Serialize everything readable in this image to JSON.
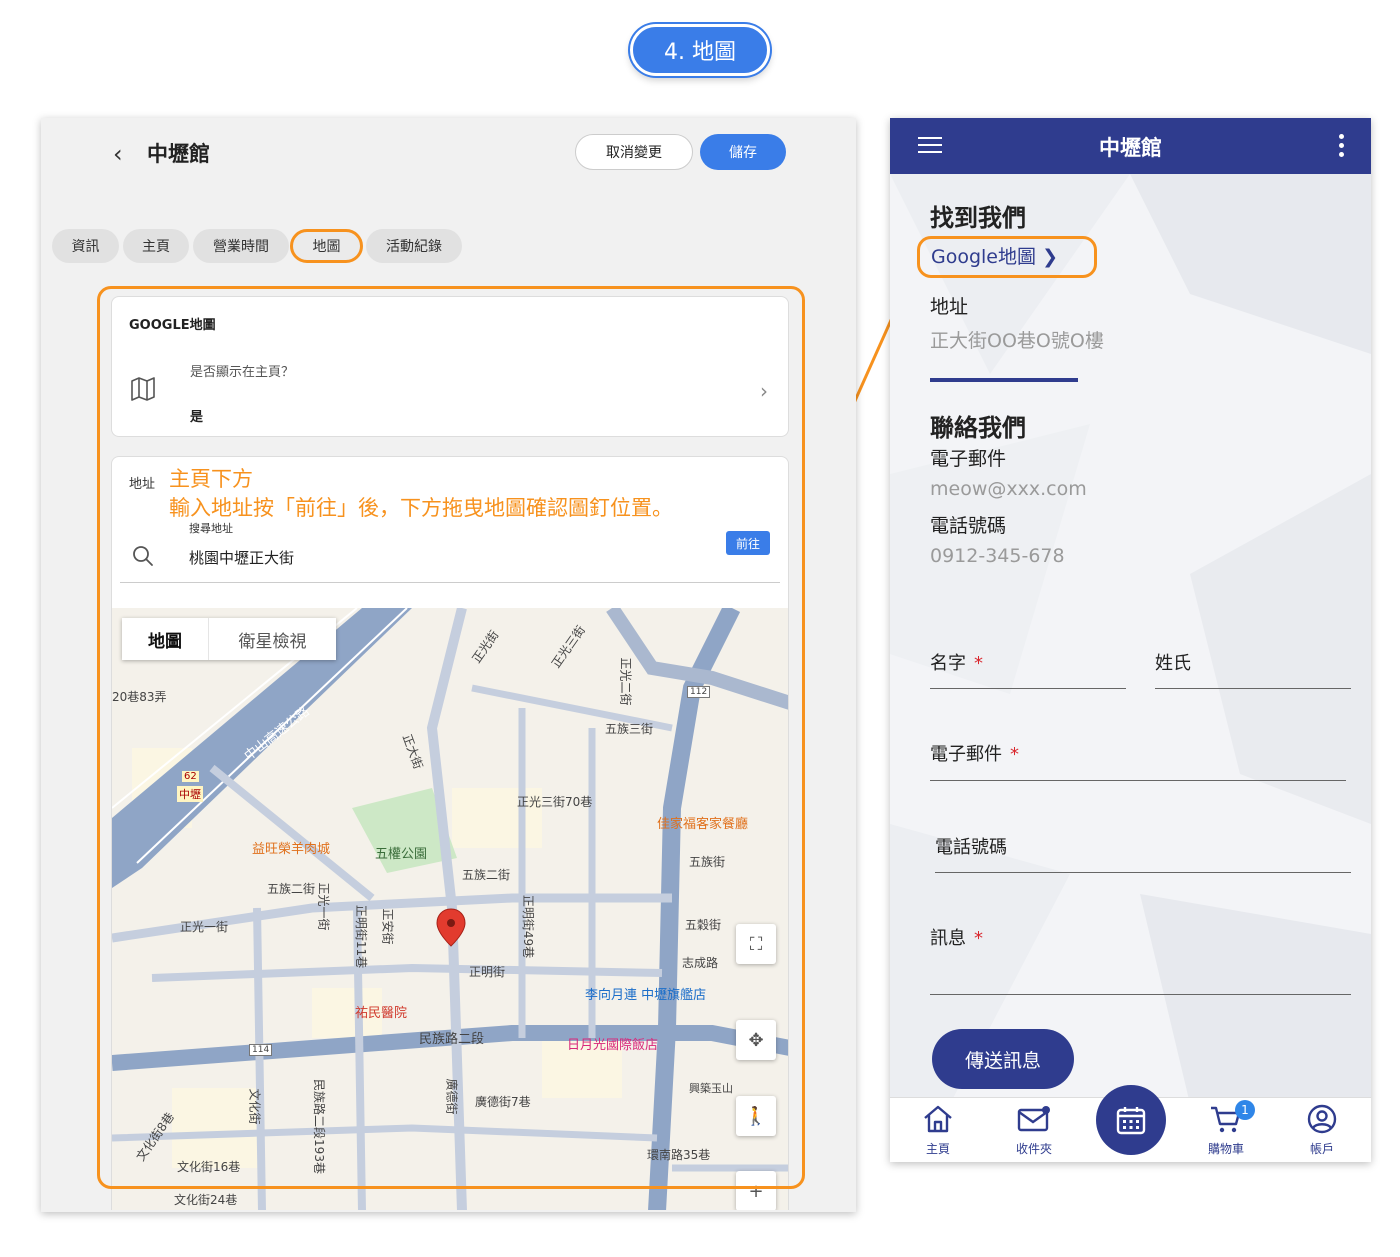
{
  "step": {
    "label": "4. 地圖"
  },
  "admin": {
    "title": "中壢館",
    "cancel_label": "取消變更",
    "save_label": "儲存",
    "tabs": [
      {
        "label": "資訊"
      },
      {
        "label": "主頁"
      },
      {
        "label": "營業時間"
      },
      {
        "label": "地圖",
        "active": true
      },
      {
        "label": "活動紀錄"
      }
    ],
    "google_map_card": {
      "heading": "GOOGLE地圖",
      "question": "是否顯示在主頁？",
      "answer": "是",
      "icon": "map-icon"
    },
    "address_card": {
      "label": "地址",
      "note_line1": "主頁下方",
      "note_line2": "輸入地址按「前往」後，下方拖曳地圖確認圖釘位置。",
      "search_label": "搜尋地址",
      "search_value": "桃園中壢正大街",
      "go_label": "前往"
    },
    "map": {
      "toggle_map": "地圖",
      "toggle_satellite": "衛星檢視",
      "labels": {
        "l1": "20巷83弄",
        "l2": "中山高速公路",
        "l3": "正光街",
        "l4": "正光三街",
        "l5": "正光二街",
        "l6": "五族三街",
        "l7": "正大街",
        "l8": "正光三街70巷",
        "l9": "佳家福客家餐廳",
        "l10": "益旺榮羊肉城",
        "l11": "五權公園",
        "l12": "五族二街",
        "l13": "五族二街",
        "l14": "五族街",
        "l15": "正光一街",
        "l16": "五穀街",
        "l17": "志成路",
        "l18": "正明街",
        "l19": "李向月連 中壢旗艦店",
        "l20": "祐民醫院",
        "l21": "民族路二段",
        "l22": "日月光國際飯店",
        "l23": "興築玉山",
        "l24": "廣德街7巷",
        "l25": "文化街16巷",
        "l26": "文化街24巷",
        "l27": "環南路35巷",
        "l28": "中壢",
        "l29": "62",
        "l30": "112",
        "l31": "114",
        "l32": "正光一街",
        "l33": "正明街11巷",
        "l34": "正明街49巷",
        "l35": "正安街",
        "l36": "文化街",
        "l37": "民族路二段193巷",
        "l38": "廣德街",
        "l39": "文化街8巷"
      }
    }
  },
  "phone": {
    "title": "中壢館",
    "find_us": "找到我們",
    "google_map_link": "Google地圖",
    "address_label": "地址",
    "address_value": "正大街OO巷O號O樓",
    "contact_us": "聯絡我們",
    "email_label": "電子郵件",
    "email_value": "meow@xxx.com",
    "phone_label": "電話號碼",
    "phone_value": "0912-345-678",
    "form": {
      "first_name": "名字",
      "last_name": "姓氏",
      "email": "電子郵件",
      "phone": "電話號碼",
      "message": "訊息",
      "required_mark": "*",
      "send_label": "傳送訊息"
    },
    "nav": {
      "home": "主頁",
      "inbox": "收件夾",
      "cart": "購物車",
      "cart_count": "1",
      "account": "帳戶"
    }
  },
  "colors": {
    "accent_blue": "#3a7de8",
    "brand_navy": "#2f3c8e",
    "highlight_orange": "#f7921e"
  }
}
